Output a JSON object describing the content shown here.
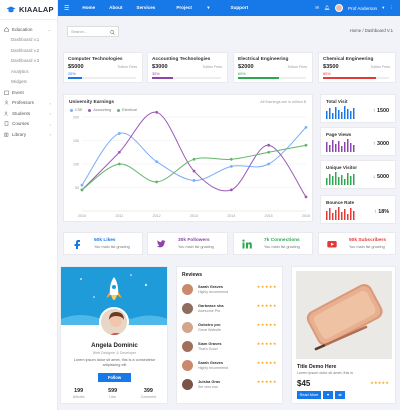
{
  "brand": {
    "name": "KIAALAP"
  },
  "sidebar": {
    "education": "Education",
    "sub": [
      "Dashboard v.1",
      "Dashboard v.2",
      "Dashboard v.3",
      "Analytics",
      "Widgets"
    ],
    "items": [
      "Event",
      "Professors",
      "Students",
      "Courses",
      "Library"
    ]
  },
  "topbar": {
    "menu": [
      "Home",
      "About",
      "Services",
      "Project",
      "Support"
    ],
    "user": "Prof Anderson"
  },
  "search": {
    "placeholder": "Search..."
  },
  "breadcrumb": "Home / Dashboard V.1",
  "stats": [
    {
      "title": "Computer Technologies",
      "value": "$5000",
      "sub": "Tuition Fees",
      "pct": "20%",
      "progress": 0.2,
      "color": "#1778e8"
    },
    {
      "title": "Accounting Technologies",
      "value": "$3000",
      "sub": "Tuition Fees",
      "pct": "30%",
      "progress": 0.3,
      "color": "#8e44ad"
    },
    {
      "title": "Electrical Engineering",
      "value": "$2000",
      "sub": "Tuition Fees",
      "pct": "60%",
      "progress": 0.6,
      "color": "#2ea84f"
    },
    {
      "title": "Chemical Engineering",
      "value": "$3500",
      "sub": "Tuition Fees",
      "pct": "80%",
      "progress": 0.8,
      "color": "#e53935"
    }
  ],
  "earnings": {
    "title": "University Earnings",
    "note": "All Earnings are in million $",
    "legend": [
      {
        "name": "CSE",
        "color": "#7aaef5"
      },
      {
        "name": "Accounting",
        "color": "#9b59b6"
      },
      {
        "name": "Electrical",
        "color": "#64b56a"
      }
    ]
  },
  "chart_data": {
    "type": "line",
    "title": "University Earnings",
    "x": [
      "2010",
      "2011",
      "2012",
      "2013",
      "2014",
      "2015",
      "2016"
    ],
    "ylim": [
      0,
      200
    ],
    "yticks": [
      50,
      100,
      150,
      200
    ],
    "series": [
      {
        "name": "CSE",
        "color": "#7aaef5",
        "values": [
          55,
          165,
          105,
          65,
          95,
          100,
          178
        ]
      },
      {
        "name": "Accounting",
        "color": "#9b59b6",
        "values": [
          45,
          125,
          210,
          85,
          45,
          140,
          30
        ]
      },
      {
        "name": "Electrical",
        "color": "#64b56a",
        "values": [
          45,
          100,
          62,
          110,
          110,
          125,
          140
        ]
      }
    ]
  },
  "right_stats": [
    {
      "title": "Total Visit",
      "value": "1500",
      "arrow": "up",
      "color": "#1778e8"
    },
    {
      "title": "Page Views",
      "value": "3000",
      "arrow": "up",
      "color": "#8e44ad"
    },
    {
      "title": "Unique Visitor",
      "value": "5000",
      "arrow": "down",
      "color": "#2ea84f"
    },
    {
      "title": "Bounce Rate",
      "value": "18%",
      "arrow": "up",
      "color": "#e53935"
    }
  ],
  "social": [
    {
      "title": "50k Likes",
      "sub": "You main list growing",
      "color": "#1778e8",
      "icon": "facebook-icon"
    },
    {
      "title": "30k Followers",
      "sub": "You main list growing",
      "color": "#8e44ad",
      "icon": "twitter-icon"
    },
    {
      "title": "7k Connections",
      "sub": "You main list growing",
      "color": "#2ea84f",
      "icon": "linkedin-icon"
    },
    {
      "title": "50k Subscribers",
      "sub": "You main list growing",
      "color": "#e53935",
      "icon": "youtube-icon"
    }
  ],
  "profile": {
    "name": "Angela Dominic",
    "role": "Web Designer & Developer",
    "text": "Lorem ipsum dolor sit amet, this is a consectetur adipisicing elit",
    "follow": "Follow",
    "stats": [
      {
        "n": "199",
        "l": "Articles"
      },
      {
        "n": "599",
        "l": "Like"
      },
      {
        "n": "399",
        "l": "Comment"
      }
    ]
  },
  "reviews": {
    "title": "Reviews",
    "items": [
      {
        "name": "Sarah Graves",
        "sub": "Highly recommend"
      },
      {
        "name": "Garbease sha",
        "sub": "Awesome Pro"
      },
      {
        "name": "Gobetro pro",
        "sub": "Great Website"
      },
      {
        "name": "Siam Graves",
        "sub": "That's Good"
      },
      {
        "name": "Sarah Graves",
        "sub": "Highly recommend"
      },
      {
        "name": "Julsha Grav",
        "sub": "Sei vero eos"
      }
    ],
    "stars": "★★★★★"
  },
  "product": {
    "title": "Title Demo Here",
    "desc": "Lorem ipsum dolor sit amet, this is",
    "price": "$45",
    "stars": "★★★★★",
    "read_more": "Read More"
  }
}
